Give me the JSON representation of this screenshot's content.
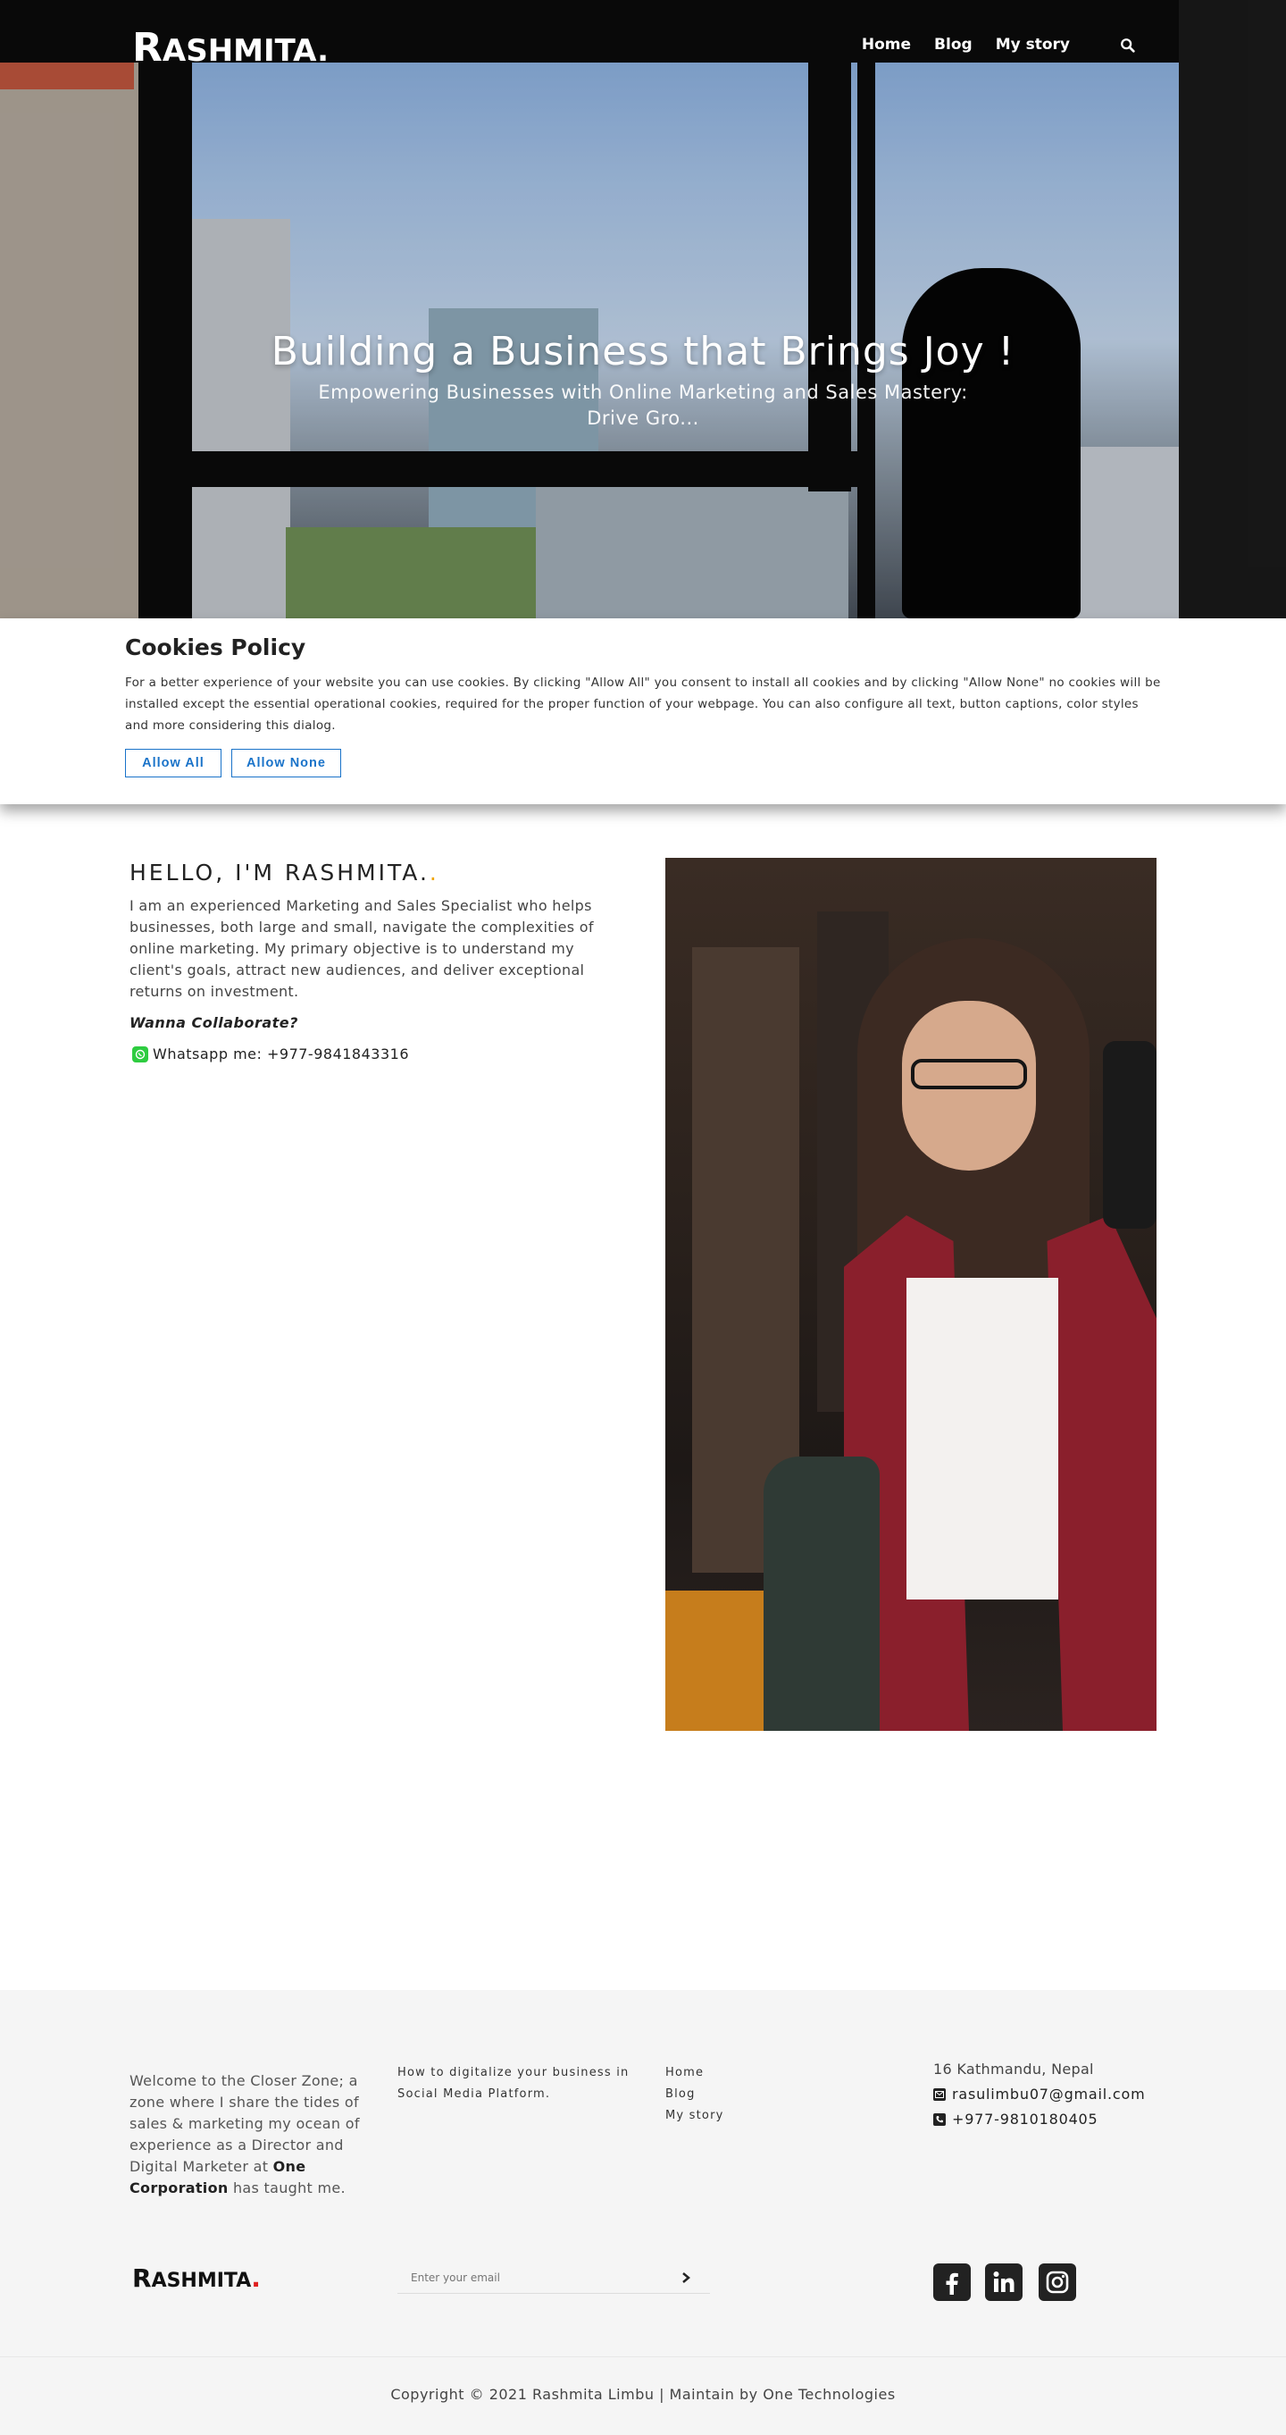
{
  "header": {
    "logo_big": "R",
    "logo_rest": "ASHMITA.",
    "nav": [
      "Home",
      "Blog",
      "My story"
    ],
    "search_icon": "search-icon"
  },
  "hero": {
    "title": "Building a Business that Brings Joy !",
    "subtitle": "Empowering Businesses with Online Marketing and Sales Mastery: Drive Gro..."
  },
  "cookies": {
    "title": "Cookies Policy",
    "text": "For a better experience of your website you can use cookies. By clicking \"Allow All\" you consent to install all cookies and by clicking \"Allow None\" no cookies will be installed except the essential operational cookies, required for the proper function of your webpage. You can also configure all text, button captions, color styles and more considering this dialog.",
    "allow_all": "Allow All",
    "allow_none": "Allow None"
  },
  "about": {
    "title": "HELLO, I'M RASHMITA.",
    "dot": ".",
    "text": "I am an experienced Marketing and Sales Specialist who helps businesses, both large and small, navigate the complexities of online marketing. My primary objective is to understand my client's goals, attract new audiences, and deliver exceptional returns on investment.",
    "collab": "Wanna Collaborate?",
    "whatsapp": "Whatsapp me: +977-9841843316"
  },
  "footer": {
    "welcome_pre": "Welcome to the Closer Zone; a zone where I share the tides of sales & marketing my ocean of experience as a Director and Digital Marketer at ",
    "welcome_company": "One Corporation",
    "welcome_post": " has taught me.",
    "article": "How to digitalize your business in Social Media Platform.",
    "links": [
      "Home",
      "Blog",
      "My story"
    ],
    "address": "16 Kathmandu, Nepal",
    "email": "rasulimbu07@gmail.com",
    "phone": "+977-9810180405",
    "logo_big": "R",
    "logo_rest": "ASHMITA",
    "logo_dot": ".",
    "email_placeholder": "Enter your email",
    "social": [
      "facebook-icon",
      "linkedin-icon",
      "instagram-icon"
    ],
    "copyright": "Copyright © 2021 Rashmita Limbu | Maintain by One Technologies"
  }
}
